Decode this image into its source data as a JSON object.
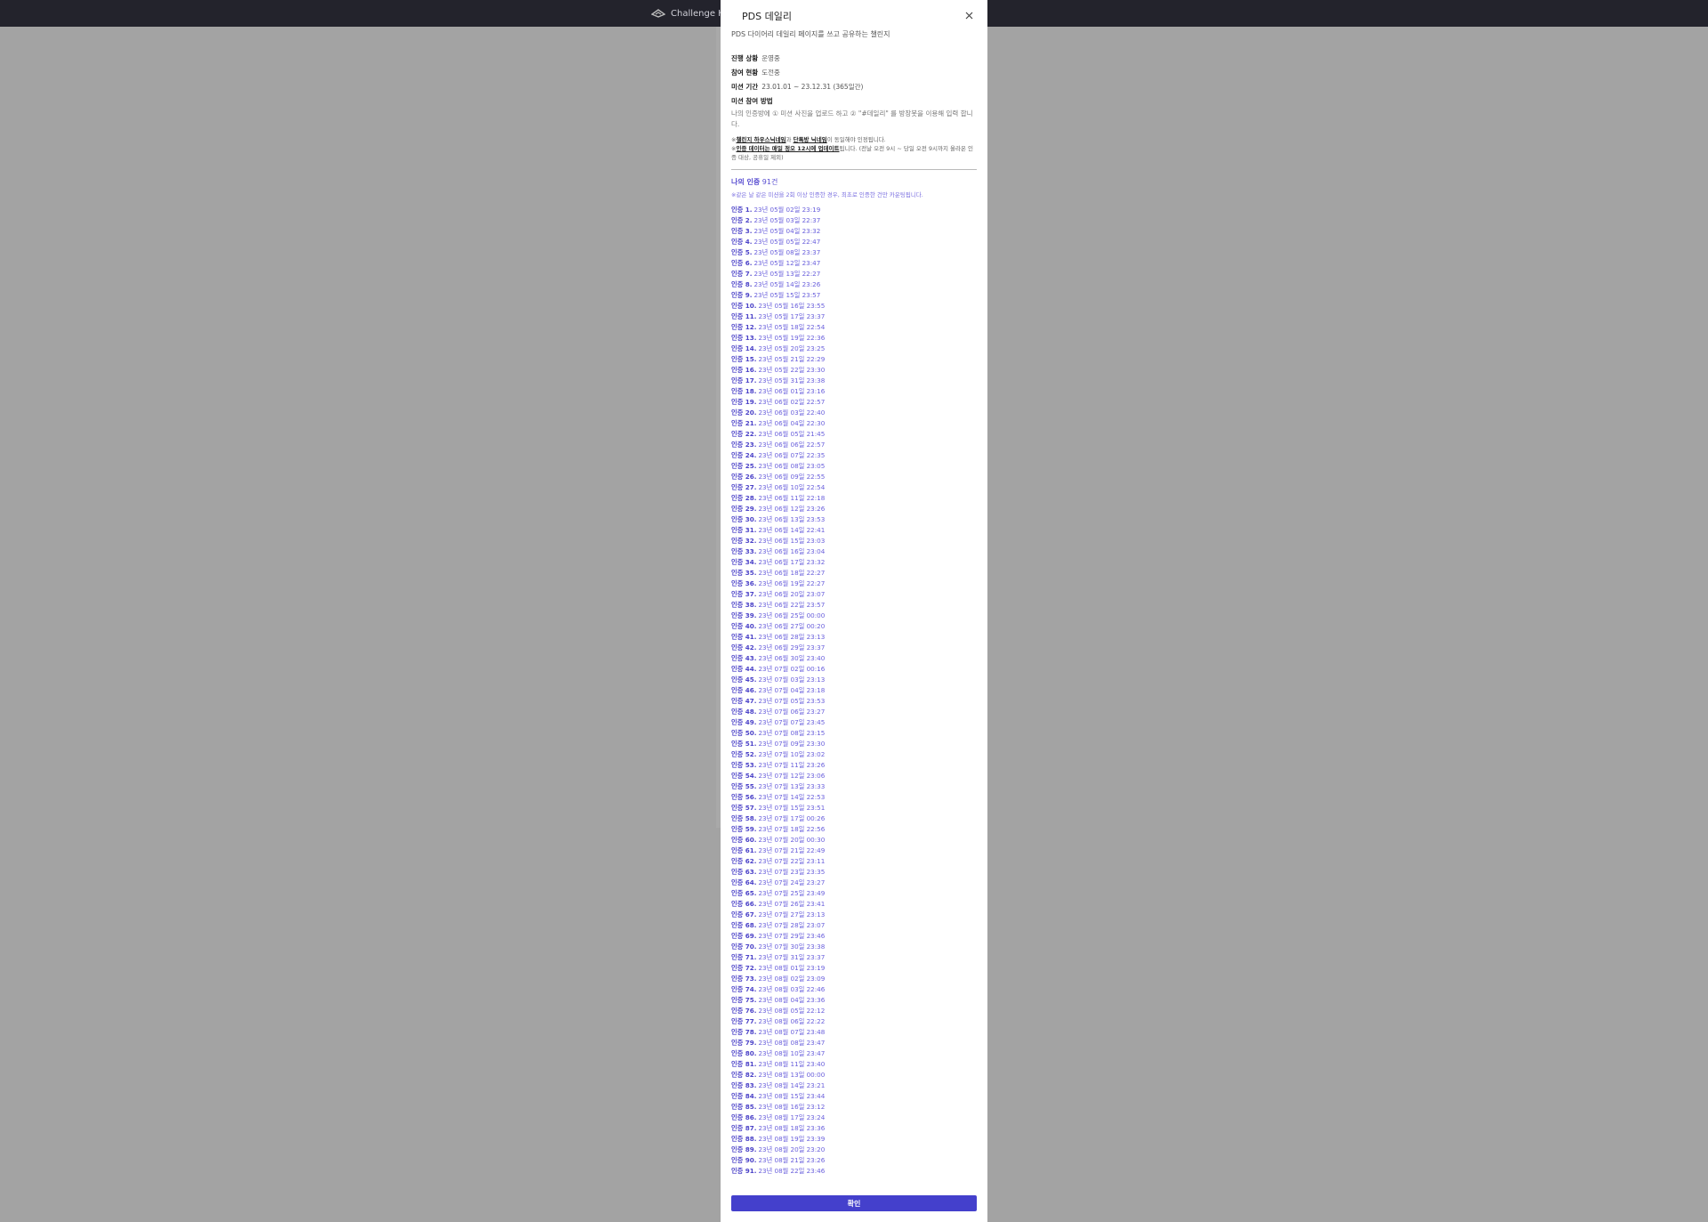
{
  "app": {
    "brand_name": "Challenge Hou"
  },
  "modal": {
    "title": "PDS 데일리",
    "subtitle": "PDS 다이어리 데일리 페이지를 쓰고 공유하는 챌린지",
    "status_label": "진행 상황",
    "status_value": "운영중",
    "participation_label": "참여 현황",
    "participation_value": "도전중",
    "period_label": "미션 기간",
    "period_value": "23.01.01 ~ 23.12.31 (365일간)",
    "method_label": "미션 참여 방법",
    "method_desc": "나의 인증방에 ① 미션 사진을 업로드 하고 ② \"#데일리\" 를 방장봇을 이용해 입력 합니다.",
    "note1_prefix": "※",
    "note1_u1": "챌린지 하우스닉네임",
    "note1_mid": "과 ",
    "note1_u2": "단톡방 닉네임",
    "note1_suffix": "이 동일해야 인정됩니다.",
    "note2_prefix": "※",
    "note2_u1": "인증 데이터는 매일 정오 12시에 업데이트",
    "note2_suffix": "됩니다. (전날 오전 9시 ~ 당일 오전 9시까지 올라온 인증 대상, 공휴일 제외)",
    "my_cert_label": "나의 인증",
    "my_cert_count": "91건",
    "cert_note": "※같은 날 같은 미션을 2회 이상 인증한 경우, 최초로 인증한 건만 카운팅됩니다.",
    "confirm_label": "확인"
  },
  "certifications": [
    {
      "n": "인증 1.",
      "t": "23년 05월 02일 23:19"
    },
    {
      "n": "인증 2.",
      "t": "23년 05월 03일 22:37"
    },
    {
      "n": "인증 3.",
      "t": "23년 05월 04일 23:32"
    },
    {
      "n": "인증 4.",
      "t": "23년 05월 05일 22:47"
    },
    {
      "n": "인증 5.",
      "t": "23년 05월 08일 23:37"
    },
    {
      "n": "인증 6.",
      "t": "23년 05월 12일 23:47"
    },
    {
      "n": "인증 7.",
      "t": "23년 05월 13일 22:27"
    },
    {
      "n": "인증 8.",
      "t": "23년 05월 14일 23:26"
    },
    {
      "n": "인증 9.",
      "t": "23년 05월 15일 23:57"
    },
    {
      "n": "인증 10.",
      "t": "23년 05월 16일 23:55"
    },
    {
      "n": "인증 11.",
      "t": "23년 05월 17일 23:37"
    },
    {
      "n": "인증 12.",
      "t": "23년 05월 18일 22:54"
    },
    {
      "n": "인증 13.",
      "t": "23년 05월 19일 22:36"
    },
    {
      "n": "인증 14.",
      "t": "23년 05월 20일 23:25"
    },
    {
      "n": "인증 15.",
      "t": "23년 05월 21일 22:29"
    },
    {
      "n": "인증 16.",
      "t": "23년 05월 22일 23:30"
    },
    {
      "n": "인증 17.",
      "t": "23년 05월 31일 23:38"
    },
    {
      "n": "인증 18.",
      "t": "23년 06월 01일 23:16"
    },
    {
      "n": "인증 19.",
      "t": "23년 06월 02일 22:57"
    },
    {
      "n": "인증 20.",
      "t": "23년 06월 03일 22:40"
    },
    {
      "n": "인증 21.",
      "t": "23년 06월 04일 22:30"
    },
    {
      "n": "인증 22.",
      "t": "23년 06월 05일 21:45"
    },
    {
      "n": "인증 23.",
      "t": "23년 06월 06일 22:57"
    },
    {
      "n": "인증 24.",
      "t": "23년 06월 07일 22:35"
    },
    {
      "n": "인증 25.",
      "t": "23년 06월 08일 23:05"
    },
    {
      "n": "인증 26.",
      "t": "23년 06월 09일 22:55"
    },
    {
      "n": "인증 27.",
      "t": "23년 06월 10일 22:54"
    },
    {
      "n": "인증 28.",
      "t": "23년 06월 11일 22:18"
    },
    {
      "n": "인증 29.",
      "t": "23년 06월 12일 23:26"
    },
    {
      "n": "인증 30.",
      "t": "23년 06월 13일 23:53"
    },
    {
      "n": "인증 31.",
      "t": "23년 06월 14일 22:41"
    },
    {
      "n": "인증 32.",
      "t": "23년 06월 15일 23:03"
    },
    {
      "n": "인증 33.",
      "t": "23년 06월 16일 23:04"
    },
    {
      "n": "인증 34.",
      "t": "23년 06월 17일 23:32"
    },
    {
      "n": "인증 35.",
      "t": "23년 06월 18일 22:27"
    },
    {
      "n": "인증 36.",
      "t": "23년 06월 19일 22:27"
    },
    {
      "n": "인증 37.",
      "t": "23년 06월 20일 23:07"
    },
    {
      "n": "인증 38.",
      "t": "23년 06월 22일 23:57"
    },
    {
      "n": "인증 39.",
      "t": "23년 06월 25일 00:00"
    },
    {
      "n": "인증 40.",
      "t": "23년 06월 27일 00:20"
    },
    {
      "n": "인증 41.",
      "t": "23년 06월 28일 23:13"
    },
    {
      "n": "인증 42.",
      "t": "23년 06월 29일 23:37"
    },
    {
      "n": "인증 43.",
      "t": "23년 06월 30일 23:40"
    },
    {
      "n": "인증 44.",
      "t": "23년 07월 02일 00:16"
    },
    {
      "n": "인증 45.",
      "t": "23년 07월 03일 23:13"
    },
    {
      "n": "인증 46.",
      "t": "23년 07월 04일 23:18"
    },
    {
      "n": "인증 47.",
      "t": "23년 07월 05일 23:53"
    },
    {
      "n": "인증 48.",
      "t": "23년 07월 06일 23:27"
    },
    {
      "n": "인증 49.",
      "t": "23년 07월 07일 23:45"
    },
    {
      "n": "인증 50.",
      "t": "23년 07월 08일 23:15"
    },
    {
      "n": "인증 51.",
      "t": "23년 07월 09일 23:30"
    },
    {
      "n": "인증 52.",
      "t": "23년 07월 10일 23:02"
    },
    {
      "n": "인증 53.",
      "t": "23년 07월 11일 23:26"
    },
    {
      "n": "인증 54.",
      "t": "23년 07월 12일 23:06"
    },
    {
      "n": "인증 55.",
      "t": "23년 07월 13일 23:33"
    },
    {
      "n": "인증 56.",
      "t": "23년 07월 14일 22:53"
    },
    {
      "n": "인증 57.",
      "t": "23년 07월 15일 23:51"
    },
    {
      "n": "인증 58.",
      "t": "23년 07월 17일 00:26"
    },
    {
      "n": "인증 59.",
      "t": "23년 07월 18일 22:56"
    },
    {
      "n": "인증 60.",
      "t": "23년 07월 20일 00:30"
    },
    {
      "n": "인증 61.",
      "t": "23년 07월 21일 22:49"
    },
    {
      "n": "인증 62.",
      "t": "23년 07월 22일 23:11"
    },
    {
      "n": "인증 63.",
      "t": "23년 07월 23일 23:35"
    },
    {
      "n": "인증 64.",
      "t": "23년 07월 24일 23:27"
    },
    {
      "n": "인증 65.",
      "t": "23년 07월 25일 23:49"
    },
    {
      "n": "인증 66.",
      "t": "23년 07월 26일 23:41"
    },
    {
      "n": "인증 67.",
      "t": "23년 07월 27일 23:13"
    },
    {
      "n": "인증 68.",
      "t": "23년 07월 28일 23:07"
    },
    {
      "n": "인증 69.",
      "t": "23년 07월 29일 23:46"
    },
    {
      "n": "인증 70.",
      "t": "23년 07월 30일 23:38"
    },
    {
      "n": "인증 71.",
      "t": "23년 07월 31일 23:37"
    },
    {
      "n": "인증 72.",
      "t": "23년 08월 01일 23:19"
    },
    {
      "n": "인증 73.",
      "t": "23년 08월 02일 23:09"
    },
    {
      "n": "인증 74.",
      "t": "23년 08월 03일 22:46"
    },
    {
      "n": "인증 75.",
      "t": "23년 08월 04일 23:36"
    },
    {
      "n": "인증 76.",
      "t": "23년 08월 05일 22:12"
    },
    {
      "n": "인증 77.",
      "t": "23년 08월 06일 22:22"
    },
    {
      "n": "인증 78.",
      "t": "23년 08월 07일 23:48"
    },
    {
      "n": "인증 79.",
      "t": "23년 08월 08일 23:47"
    },
    {
      "n": "인증 80.",
      "t": "23년 08월 10일 23:47"
    },
    {
      "n": "인증 81.",
      "t": "23년 08월 11일 23:40"
    },
    {
      "n": "인증 82.",
      "t": "23년 08월 13일 00:00"
    },
    {
      "n": "인증 83.",
      "t": "23년 08월 14일 23:21"
    },
    {
      "n": "인증 84.",
      "t": "23년 08월 15일 23:44"
    },
    {
      "n": "인증 85.",
      "t": "23년 08월 16일 23:12"
    },
    {
      "n": "인증 86.",
      "t": "23년 08월 17일 23:24"
    },
    {
      "n": "인증 87.",
      "t": "23년 08월 18일 23:36"
    },
    {
      "n": "인증 88.",
      "t": "23년 08월 19일 23:39"
    },
    {
      "n": "인증 89.",
      "t": "23년 08월 20일 23:20"
    },
    {
      "n": "인증 90.",
      "t": "23년 08월 21일 23:26"
    },
    {
      "n": "인증 91.",
      "t": "23년 08월 22일 23:46"
    }
  ],
  "colors": {
    "accent": "#4440cc",
    "link_text": "#6a60dc",
    "topbar": "#23232c",
    "backdrop": "#a3a3a3"
  }
}
